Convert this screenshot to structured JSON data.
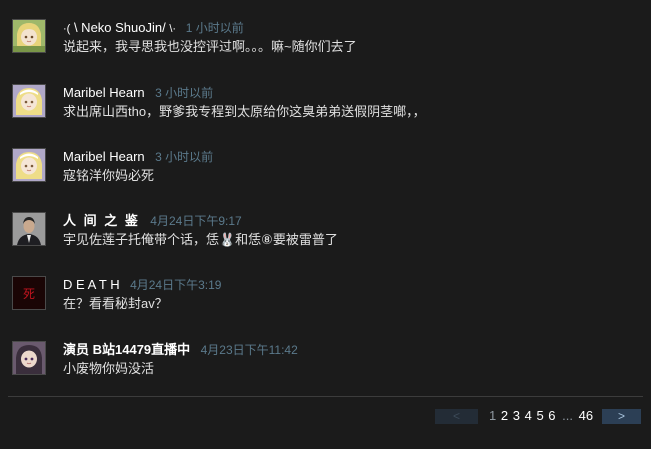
{
  "comments": [
    {
      "author": "\\ Neko ShuoJin/",
      "author_prefix": "·(",
      "author_suffix": "\\·",
      "time": "1 小时以前",
      "text": "说起来，我寻思我也没控评过啊。。。嘛~随你们去了",
      "avatar_icon": "blonde-anime-girl-avatar-icon",
      "avatar_colors": {
        "bg": "#9fb86a",
        "hair": "#e8d47a",
        "face": "#f3e3cf"
      }
    },
    {
      "author": "Maribel Hearn",
      "time": "3 小时以前",
      "text": "求出席山西tho，野爹我专程到太原给你这臭弟弟送假阴茎啷，，",
      "avatar_icon": "blonde-anime-girl-avatar-icon",
      "avatar_colors": {
        "bg": "#b0a8c8",
        "hair": "#eedd88",
        "face": "#f5e6d6"
      }
    },
    {
      "author": "Maribel Hearn",
      "time": "3 小时以前",
      "text": "寇铭洋你妈必死",
      "avatar_icon": "blonde-anime-girl-avatar-icon",
      "avatar_colors": {
        "bg": "#b0a8c8",
        "hair": "#eedd88",
        "face": "#f5e6d6"
      }
    },
    {
      "author": "人 间 之 鉴",
      "time": "4月24日下午9:17",
      "text": "宇见佐莲子托俺带个话，恁🐰和恁⑧要被雷普了",
      "avatar_icon": "man-in-suit-avatar-icon",
      "avatar_colors": {
        "bg": "#8a8a8a",
        "hair": "#222222",
        "face": "#c9a98e"
      }
    },
    {
      "author": "D E A T H",
      "time": "4月24日下午3:19",
      "text": "在？看看秘封av？",
      "avatar_icon": "death-kanji-avatar-icon",
      "avatar_glyph": "死",
      "avatar_colors": {
        "bg": "#1a0505",
        "glyph": "#c0141e"
      }
    },
    {
      "author": "演员 B站14479直播中",
      "time": "4月23日下午11:42",
      "text": "小废物你妈没活",
      "avatar_icon": "dark-haired-anime-girl-avatar-icon",
      "avatar_colors": {
        "bg": "#6a5a6e",
        "hair": "#3a2e3c",
        "face": "#ecd8cc"
      }
    }
  ],
  "pagination": {
    "prev_label": "<",
    "next_label": ">",
    "pages": [
      "1",
      "2",
      "3",
      "4",
      "5",
      "6"
    ],
    "current": "1",
    "ellipsis": "...",
    "last": "46"
  }
}
